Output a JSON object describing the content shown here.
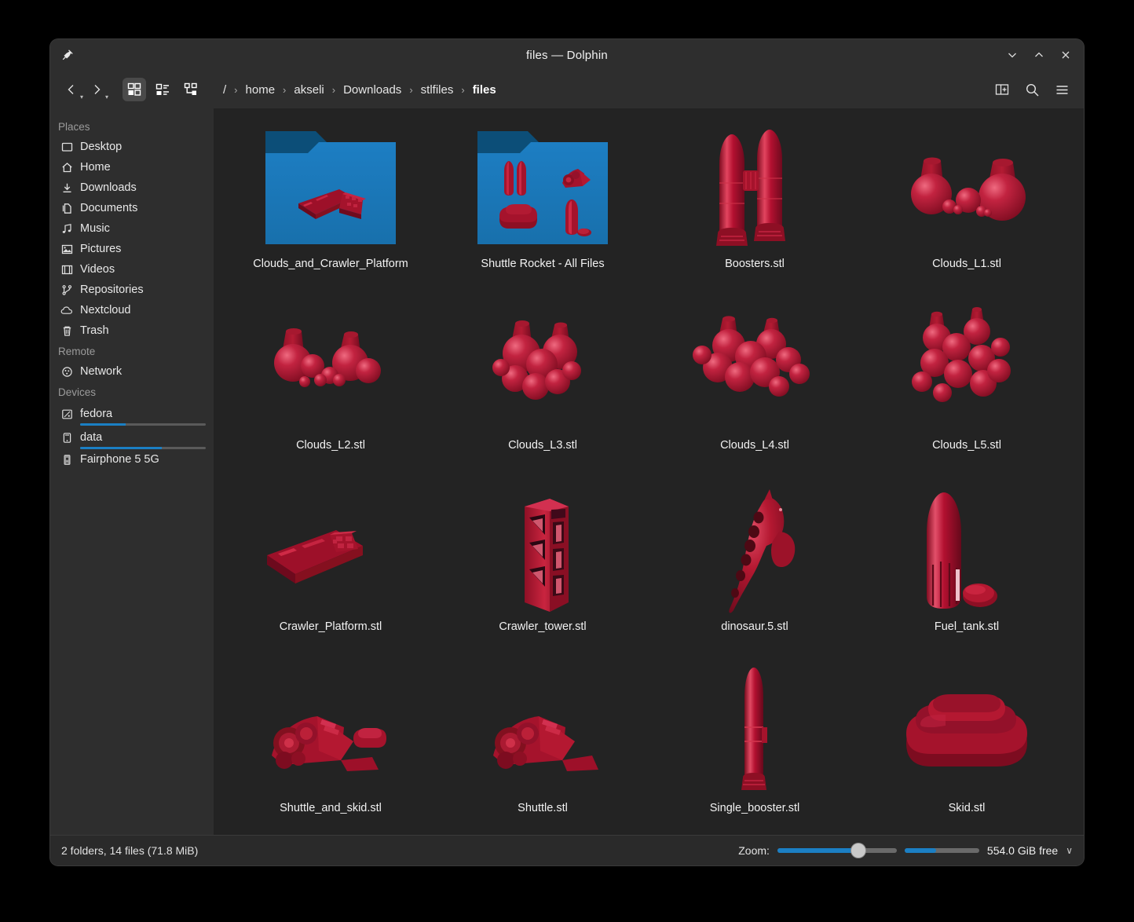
{
  "window": {
    "title": "files — Dolphin",
    "pin_icon": "pin-icon",
    "controls": [
      {
        "name": "minimize-button",
        "glyph": "∨"
      },
      {
        "name": "maximize-button",
        "glyph": "∧"
      },
      {
        "name": "close-button",
        "glyph": "✕"
      }
    ]
  },
  "toolbar": {
    "back_label": "‹",
    "forward_label": "›",
    "view_modes": [
      {
        "name": "view-mode-icons",
        "active": true
      },
      {
        "name": "view-mode-compact",
        "active": false
      },
      {
        "name": "view-mode-details",
        "active": false
      }
    ],
    "breadcrumb": [
      "/",
      "home",
      "akseli",
      "Downloads",
      "stlfiles",
      "files"
    ],
    "breadcrumb_separator": "›",
    "right_icons": [
      "split-view-icon",
      "search-icon",
      "menu-icon"
    ]
  },
  "sidebar": {
    "groups": [
      {
        "title": "Places",
        "items": [
          {
            "label": "Desktop",
            "icon": "desktop-icon"
          },
          {
            "label": "Home",
            "icon": "home-icon"
          },
          {
            "label": "Downloads",
            "icon": "downloads-icon"
          },
          {
            "label": "Documents",
            "icon": "documents-icon"
          },
          {
            "label": "Music",
            "icon": "music-icon"
          },
          {
            "label": "Pictures",
            "icon": "pictures-icon"
          },
          {
            "label": "Videos",
            "icon": "videos-icon"
          },
          {
            "label": "Repositories",
            "icon": "repositories-icon"
          },
          {
            "label": "Nextcloud",
            "icon": "cloud-icon"
          },
          {
            "label": "Trash",
            "icon": "trash-icon"
          }
        ]
      },
      {
        "title": "Remote",
        "items": [
          {
            "label": "Network",
            "icon": "network-icon"
          }
        ]
      },
      {
        "title": "Devices",
        "items": [
          {
            "label": "fedora",
            "icon": "harddisk-icon",
            "capacity_percent": 36
          },
          {
            "label": "data",
            "icon": "drive-icon",
            "capacity_percent": 65
          },
          {
            "label": "Fairphone 5 5G",
            "icon": "phone-icon"
          }
        ]
      }
    ]
  },
  "files": [
    {
      "name": "Clouds_and_Crawler_Platform",
      "type": "folder",
      "thumb": "folder-crawler-platform"
    },
    {
      "name": "Shuttle Rocket - All Files",
      "type": "folder",
      "thumb": "folder-shuttle-rocket"
    },
    {
      "name": "Boosters.stl",
      "type": "stl",
      "thumb": "boosters"
    },
    {
      "name": "Clouds_L1.stl",
      "type": "stl",
      "thumb": "clouds-l1"
    },
    {
      "name": "Clouds_L2.stl",
      "type": "stl",
      "thumb": "clouds-l2"
    },
    {
      "name": "Clouds_L3.stl",
      "type": "stl",
      "thumb": "clouds-l3"
    },
    {
      "name": "Clouds_L4.stl",
      "type": "stl",
      "thumb": "clouds-l4"
    },
    {
      "name": "Clouds_L5.stl",
      "type": "stl",
      "thumb": "clouds-l5"
    },
    {
      "name": "Crawler_Platform.stl",
      "type": "stl",
      "thumb": "crawler-platform"
    },
    {
      "name": "Crawler_tower.stl",
      "type": "stl",
      "thumb": "crawler-tower"
    },
    {
      "name": "dinosaur.5.stl",
      "type": "stl",
      "thumb": "dinosaur"
    },
    {
      "name": "Fuel_tank.stl",
      "type": "stl",
      "thumb": "fuel-tank"
    },
    {
      "name": "Shuttle_and_skid.stl",
      "type": "stl",
      "thumb": "shuttle-and-skid"
    },
    {
      "name": "Shuttle.stl",
      "type": "stl",
      "thumb": "shuttle"
    },
    {
      "name": "Single_booster.stl",
      "type": "stl",
      "thumb": "single-booster"
    },
    {
      "name": "Skid.stl",
      "type": "stl",
      "thumb": "skid"
    }
  ],
  "statusbar": {
    "summary": "2 folders, 14 files (71.8 MiB)",
    "zoom_label": "Zoom:",
    "zoom_percent": 62,
    "free_space": "554.0 GiB free",
    "free_caret": "∨"
  },
  "colors": {
    "accent": "#1b7fc4",
    "folder_body": "#1a76b8",
    "folder_tab": "#0c4e78",
    "stl_red": "#b31030",
    "stl_red_light": "#e0415e",
    "stl_red_dark": "#6e0a1e",
    "window_bg": "#2e2e2e",
    "content_bg": "#232323"
  }
}
